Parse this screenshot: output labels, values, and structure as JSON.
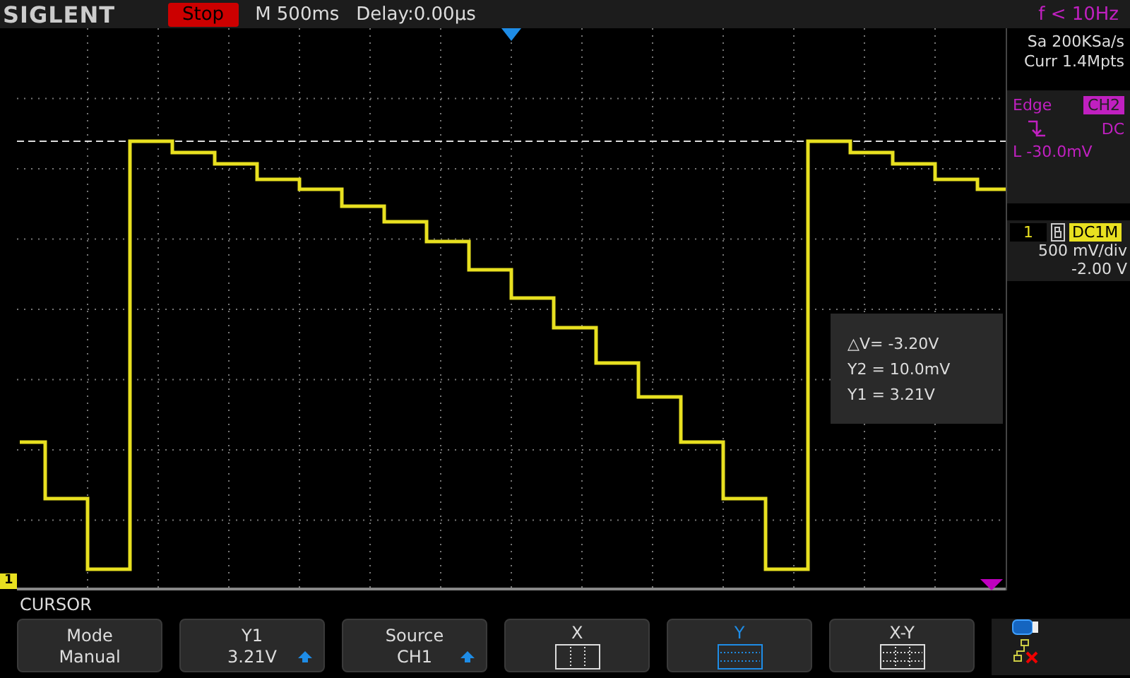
{
  "top_bar": {
    "logo": "SIGLENT",
    "run_state": "Stop",
    "timebase": "M 500ms",
    "delay": "Delay:0.00μs",
    "frequency": "f < 10Hz"
  },
  "acquisition": {
    "sample_rate": "Sa 200KSa/s",
    "memory": "Curr 1.4Mpts"
  },
  "trigger": {
    "type": "Edge",
    "source": "CH2",
    "coupling": "DC",
    "level": "L -30.0mV"
  },
  "channel": {
    "number": "1",
    "coupling": "DC1M",
    "scale": "500 mV/div",
    "offset": "-2.00 V"
  },
  "plot": {
    "channel_marker": "1"
  },
  "cursor_readout": [
    "△V= -3.20V",
    "Y2 = 10.0mV",
    "Y1 = 3.21V"
  ],
  "menu": {
    "title": "CURSOR",
    "buttons": [
      {
        "kind": "text",
        "label": "Mode",
        "value": "Manual",
        "selected": false
      },
      {
        "kind": "adjust",
        "label": "Y1",
        "value": "3.21V",
        "selected": false
      },
      {
        "kind": "adjust",
        "label": "Source",
        "value": "CH1",
        "selected": false
      },
      {
        "kind": "vertical",
        "label": "X",
        "selected": false
      },
      {
        "kind": "horizontal",
        "label": "Y",
        "selected": true
      },
      {
        "kind": "grid",
        "label": "X-Y",
        "selected": false
      }
    ]
  }
}
